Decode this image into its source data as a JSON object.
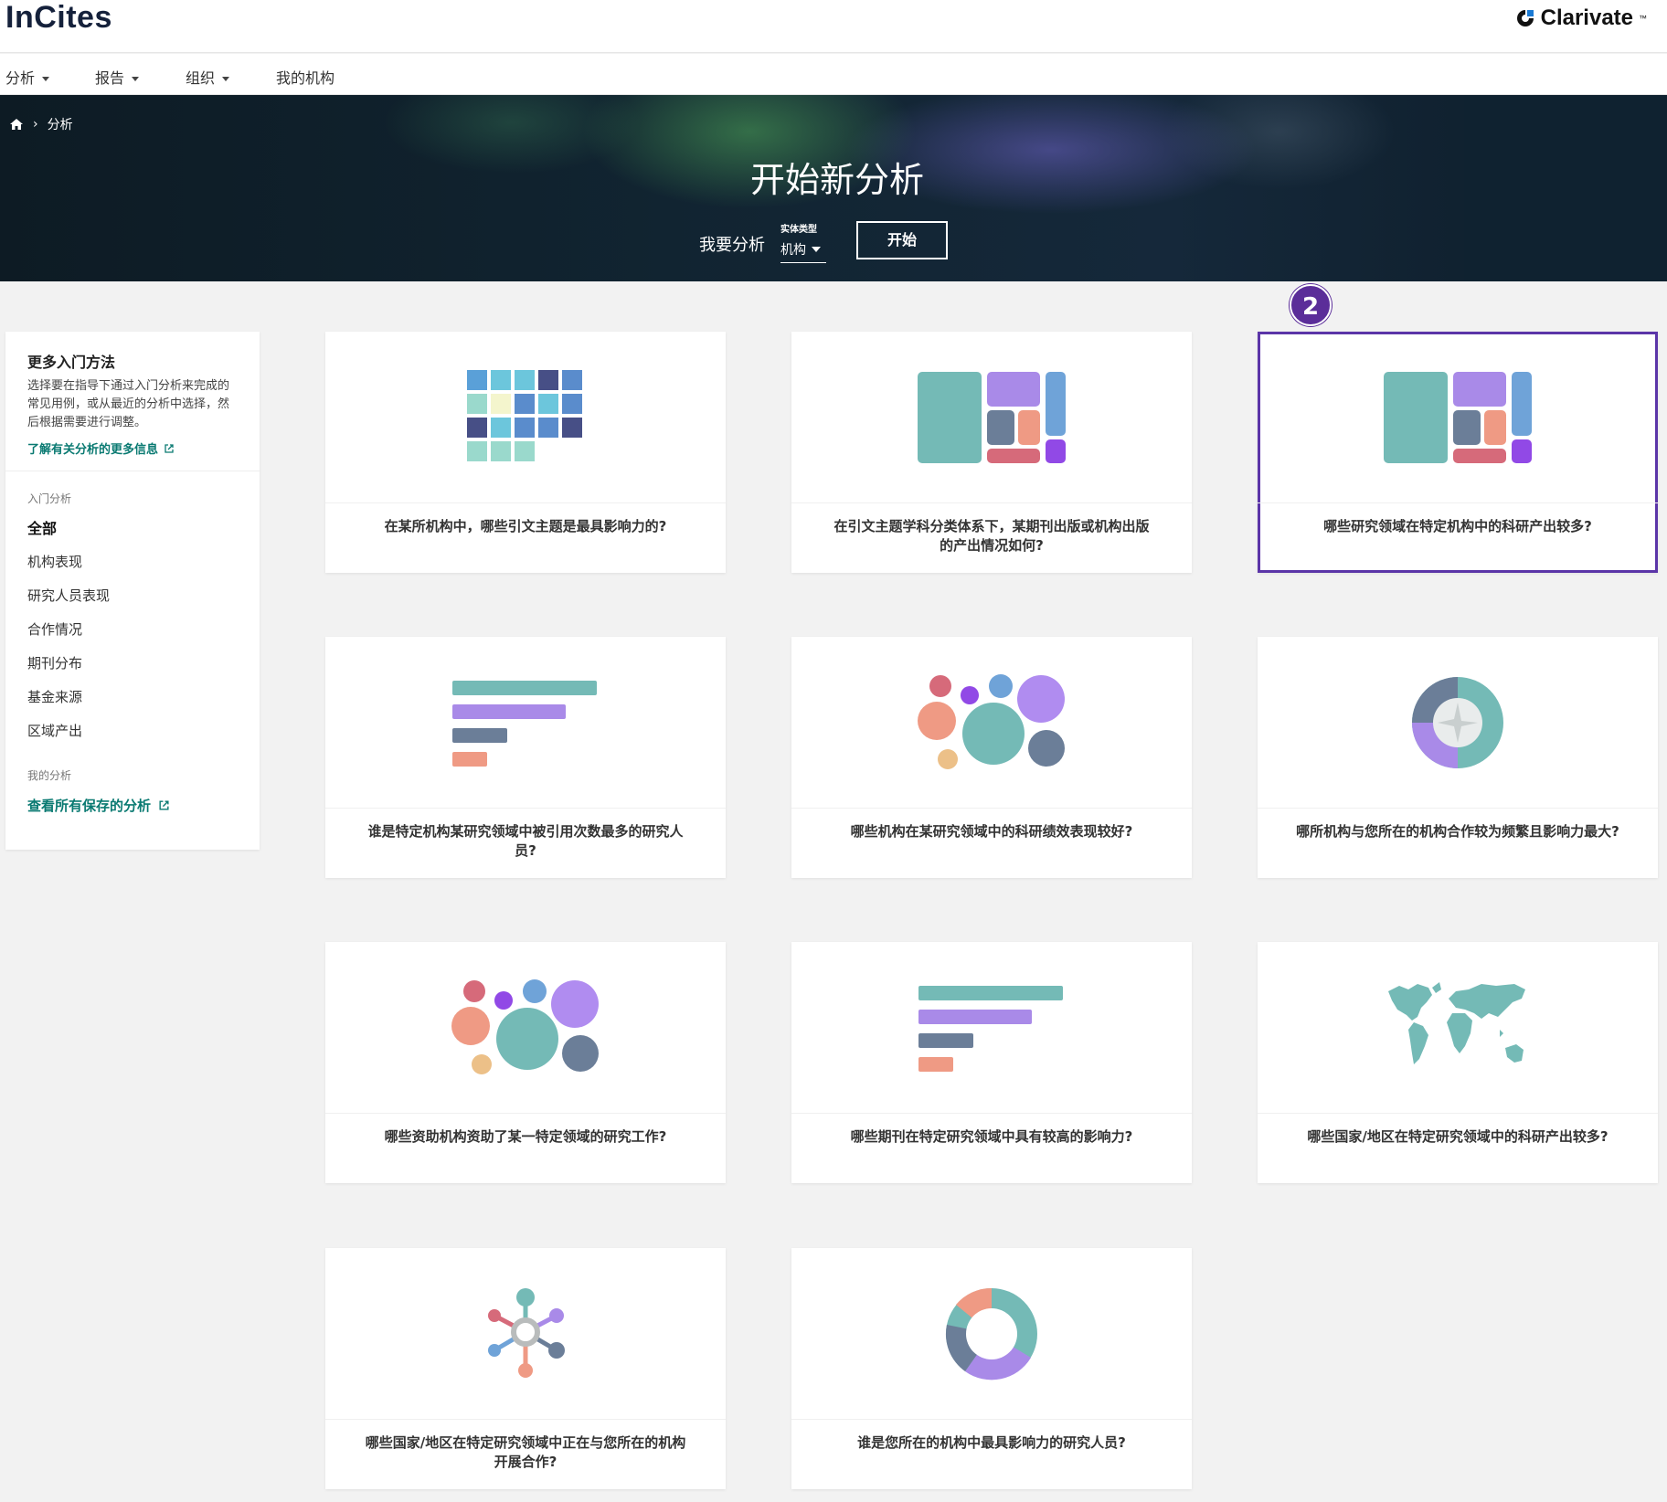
{
  "app": {
    "logo": "InCites",
    "brand": "Clarivate",
    "brand_tm": "™"
  },
  "nav": {
    "items": [
      {
        "label": "分析",
        "has_menu": true
      },
      {
        "label": "报告",
        "has_menu": true
      },
      {
        "label": "组织",
        "has_menu": true
      },
      {
        "label": "我的机构",
        "has_menu": false
      }
    ]
  },
  "hero": {
    "breadcrumb": "分析",
    "title": "开始新分析",
    "analyze_label": "我要分析",
    "entity_caption": "实体类型",
    "entity_value": "机构",
    "start_button": "开始"
  },
  "sidebar": {
    "title": "更多入门方法",
    "description": "选择要在指导下通过入门分析来完成的常见用例，或从最近的分析中选择，然后根据需要进行调整。",
    "learn_more": "了解有关分析的更多信息",
    "section_getting_started": "入门分析",
    "items": [
      "全部",
      "机构表现",
      "研究人员表现",
      "合作情况",
      "期刊分布",
      "基金来源",
      "区域产出"
    ],
    "section_my": "我的分析",
    "saved_link": "查看所有保存的分析"
  },
  "cards": [
    {
      "text": "在某所机构中，哪些引文主题是最具影响力的?",
      "icon": "heatmap-grid-icon"
    },
    {
      "text": "在引文主题学科分类体系下，某期刊出版或机构出版的产出情况如何?",
      "icon": "treemap-icon"
    },
    {
      "text": "哪些研究领域在特定机构中的科研产出较多?",
      "icon": "treemap-icon",
      "selected": true
    },
    {
      "text": "谁是特定机构某研究领域中被引用次数最多的研究人员?",
      "icon": "bar-list-icon"
    },
    {
      "text": "哪些机构在某研究领域中的科研绩效表现较好?",
      "icon": "bubble-chart-icon"
    },
    {
      "text": "哪所机构与您所在的机构合作较为频繁且影响力最大?",
      "icon": "pie-chart-icon"
    },
    {
      "text": "哪些资助机构资助了某一特定领域的研究工作?",
      "icon": "bubble-chart-icon"
    },
    {
      "text": "哪些期刊在特定研究领域中具有较高的影响力?",
      "icon": "bar-list-icon"
    },
    {
      "text": "哪些国家/地区在特定研究领域中的科研产出较多?",
      "icon": "world-map-icon"
    },
    {
      "text": "哪些国家/地区在特定研究领域中正在与您所在的机构开展合作?",
      "icon": "network-icon"
    },
    {
      "text": "谁是您所在的机构中最具影响力的研究人员?",
      "icon": "donut-chart-icon"
    }
  ],
  "step_badge": "2",
  "colors": {
    "accent_teal": "#0a7a72",
    "selection_purple": "#5b35a8",
    "badge_purple": "#5b2d99"
  }
}
